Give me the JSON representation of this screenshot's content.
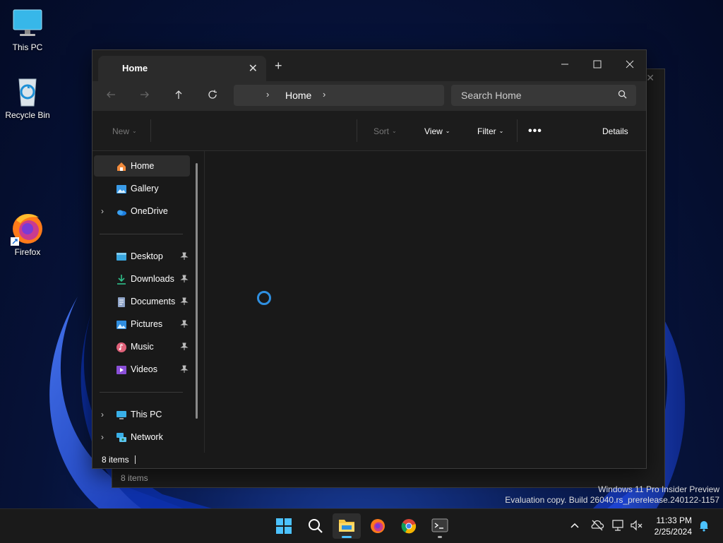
{
  "desktop": {
    "icons": [
      {
        "label": "This PC"
      },
      {
        "label": "Recycle Bin"
      },
      {
        "label": "Firefox"
      }
    ],
    "watermark": {
      "line1": "Windows 11 Pro Insider Preview",
      "line2": "Evaluation copy. Build 26040.rs_prerelease.240122-1157"
    }
  },
  "background_window": {
    "status": "8 items"
  },
  "window": {
    "tab_title": "Home",
    "address": {
      "crumb": "Home"
    },
    "search": {
      "placeholder": "Search Home"
    },
    "commands": {
      "new": "New",
      "sort": "Sort",
      "view": "View",
      "filter": "Filter",
      "more": "•••",
      "details": "Details"
    },
    "sidebar": {
      "items": [
        {
          "label": "Home",
          "icon": "home-icon",
          "selected": true
        },
        {
          "label": "Gallery",
          "icon": "gallery-icon"
        },
        {
          "label": "OneDrive",
          "icon": "onedrive-icon",
          "expandable": true
        },
        {
          "label": "Desktop",
          "icon": "desktop-icon",
          "pinned": true
        },
        {
          "label": "Downloads",
          "icon": "downloads-icon",
          "pinned": true
        },
        {
          "label": "Documents",
          "icon": "documents-icon",
          "pinned": true
        },
        {
          "label": "Pictures",
          "icon": "pictures-icon",
          "pinned": true
        },
        {
          "label": "Music",
          "icon": "music-icon",
          "pinned": true
        },
        {
          "label": "Videos",
          "icon": "videos-icon",
          "pinned": true
        },
        {
          "label": "This PC",
          "icon": "this-pc-icon",
          "expandable": true
        },
        {
          "label": "Network",
          "icon": "network-icon",
          "expandable": true
        }
      ]
    },
    "status": "8 items"
  },
  "taskbar": {
    "clock": {
      "time": "11:33 PM",
      "date": "2/25/2024"
    }
  },
  "colors": {
    "accent": "#4cc2ff",
    "spinner": "#2f8fe0",
    "window_bg": "#191919"
  }
}
